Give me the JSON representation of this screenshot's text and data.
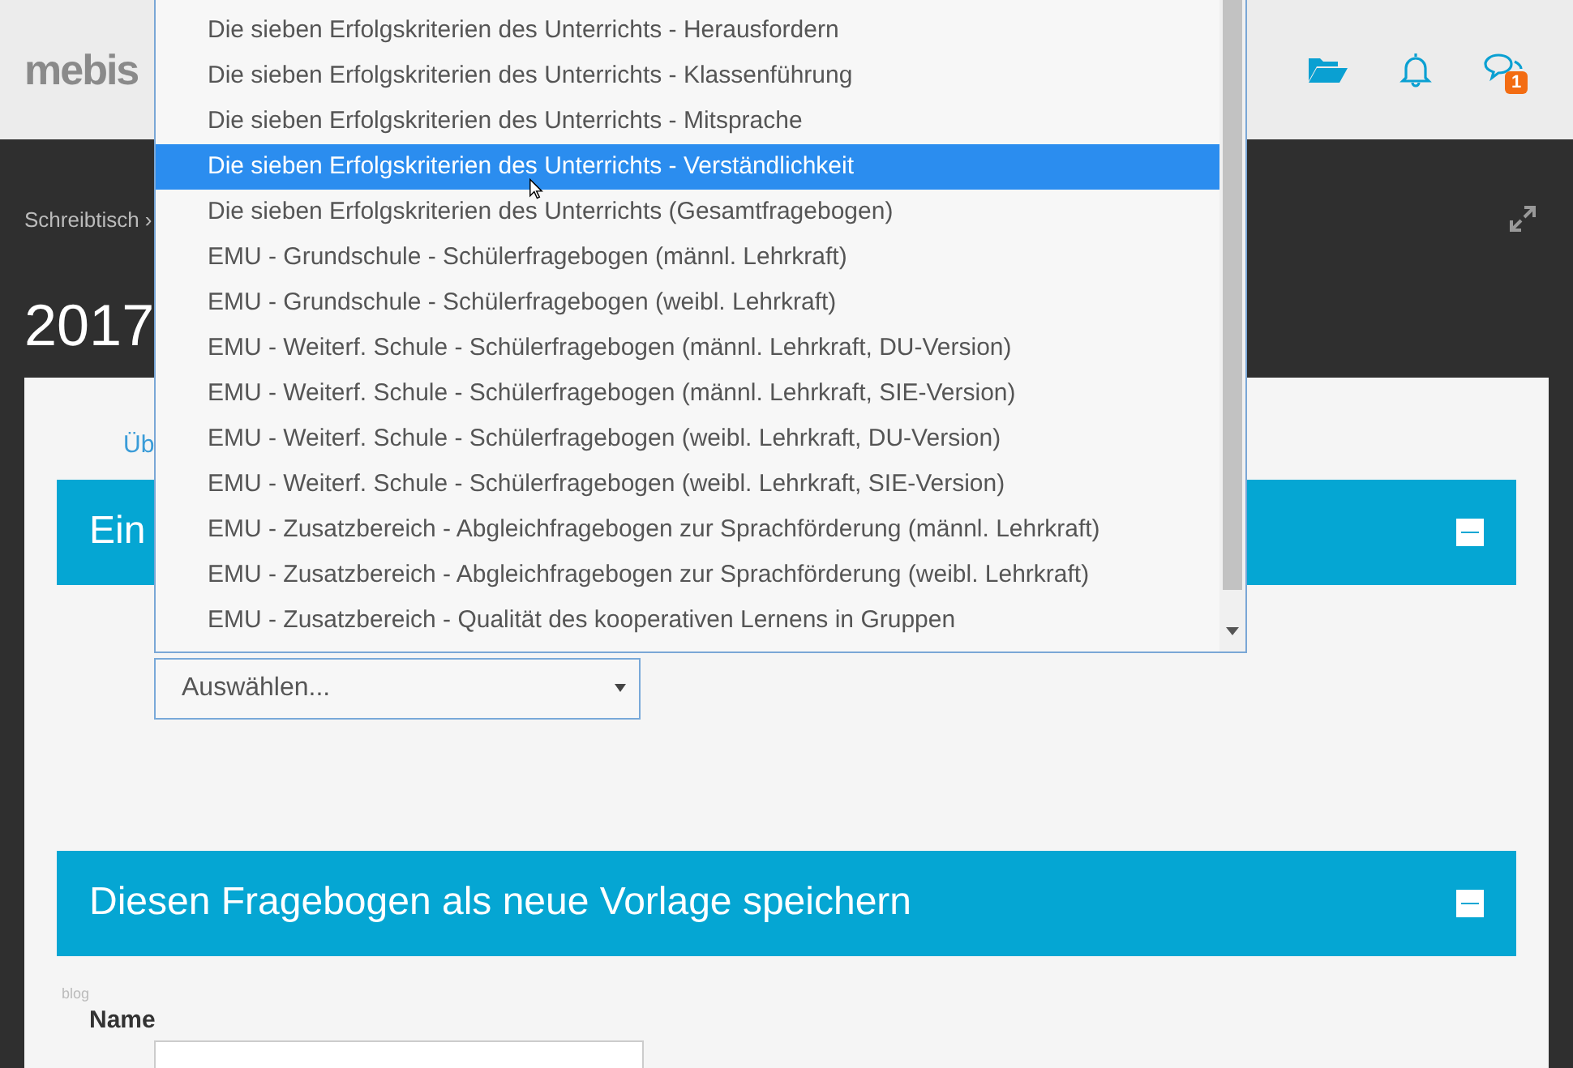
{
  "header": {
    "logo": "mebis",
    "messages_badge": "1"
  },
  "breadcrumb": "Schreibtisch ›",
  "page_title": "2017",
  "tab_link": "Üb",
  "sections": [
    {
      "title": "Ein",
      "expanded": true
    },
    {
      "title": "Diesen Fragebogen als neue Vorlage speichern",
      "expanded": true
    }
  ],
  "select": {
    "value": "Auswählen..."
  },
  "dropdown": {
    "options": [
      {
        "label": "Die sieben Erfolgskriterien des Unterrichts - Herausfordern",
        "selected": false
      },
      {
        "label": "Die sieben Erfolgskriterien des Unterrichts - Klassenführung",
        "selected": false
      },
      {
        "label": "Die sieben Erfolgskriterien des Unterrichts - Mitsprache",
        "selected": false
      },
      {
        "label": "Die sieben Erfolgskriterien des Unterrichts - Verständlichkeit",
        "selected": true
      },
      {
        "label": "Die sieben Erfolgskriterien des Unterrichts (Gesamtfragebogen)",
        "selected": false
      },
      {
        "label": "EMU - Grundschule - Schülerfragebogen (männl. Lehrkraft)",
        "selected": false
      },
      {
        "label": "EMU - Grundschule - Schülerfragebogen (weibl. Lehrkraft)",
        "selected": false
      },
      {
        "label": "EMU - Weiterf. Schule - Schülerfragebogen (männl. Lehrkraft, DU-Version)",
        "selected": false
      },
      {
        "label": "EMU - Weiterf. Schule - Schülerfragebogen (männl. Lehrkraft, SIE-Version)",
        "selected": false
      },
      {
        "label": "EMU - Weiterf. Schule - Schülerfragebogen (weibl. Lehrkraft, DU-Version)",
        "selected": false
      },
      {
        "label": "EMU - Weiterf. Schule - Schülerfragebogen (weibl. Lehrkraft, SIE-Version)",
        "selected": false
      },
      {
        "label": "EMU - Zusatzbereich - Abgleichfragebogen zur Sprachförderung (männl. Lehrkraft)",
        "selected": false
      },
      {
        "label": "EMU - Zusatzbereich - Abgleichfragebogen zur Sprachförderung (weibl. Lehrkraft)",
        "selected": false
      },
      {
        "label": "EMU - Zusatzbereich - Qualität des kooperativen Lernens in Gruppen",
        "selected": false
      }
    ]
  },
  "blog_label": "blog",
  "name_field": {
    "label": "Name"
  }
}
